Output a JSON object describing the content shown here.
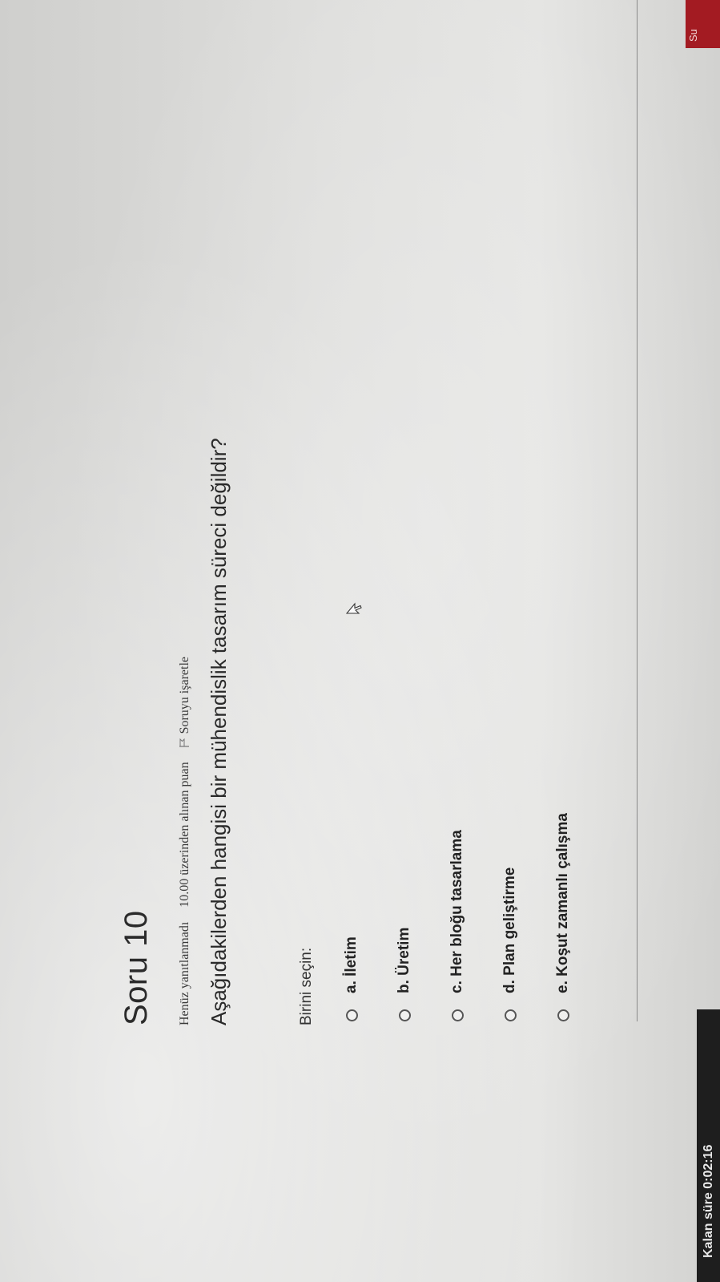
{
  "question": {
    "title": "Soru 10",
    "status": "Henüz yanıtlanmadı",
    "points": "10.00 üzerinden alınan puan",
    "flag_label": "Soruyu işaretle",
    "text": "Aşağıdakilerden hangisi bir mühendislik tasarım süreci değildir?",
    "prompt": "Birini seçin:",
    "options": [
      {
        "label": "a. İletim"
      },
      {
        "label": "b. Üretim"
      },
      {
        "label": "c. Her bloğu tasarlama"
      },
      {
        "label": "d. Plan geliştirme"
      },
      {
        "label": "e. Koşut zamanlı çalışma"
      }
    ]
  },
  "timer": {
    "label": "Kalan süre 0:02:16"
  },
  "corner_button": {
    "label": "Su"
  },
  "colors": {
    "accent_red": "#a31b22",
    "text": "#2a2a2a"
  },
  "icons": {
    "flag": "flag-icon",
    "radio": "radio-unchecked-icon",
    "cursor": "mouse-pointer-icon"
  }
}
